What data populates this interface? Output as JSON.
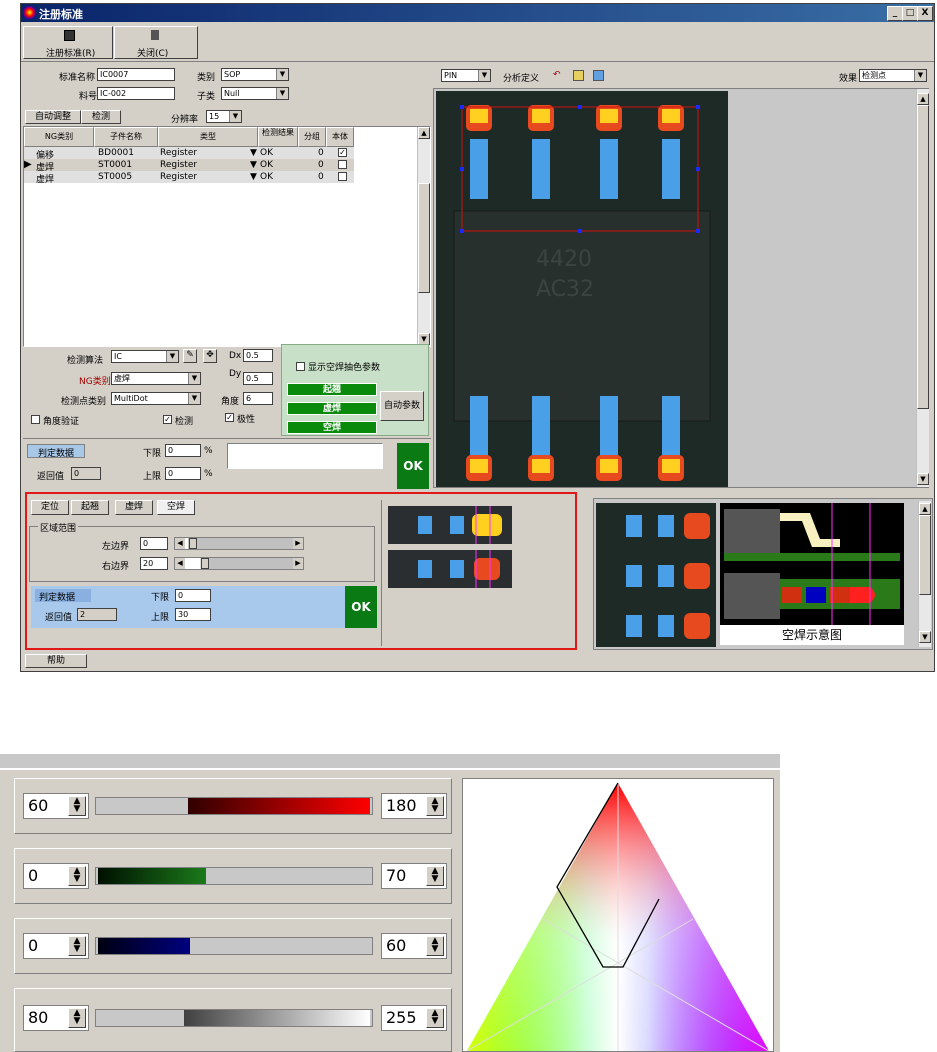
{
  "window": {
    "title": "注册标准",
    "controls": [
      "_",
      "□",
      "X"
    ]
  },
  "toolbar": {
    "register_label": "注册标准(R)",
    "close_label": "关闭(C)"
  },
  "form": {
    "std_name_label": "标准名称",
    "std_name_value": "IC0007",
    "category_label": "类别",
    "category_value": "SOP",
    "part_no_label": "料号",
    "part_no_value": "IC-002",
    "subcat_label": "子类",
    "subcat_value": "Null"
  },
  "tabs": {
    "auto_adjust": "自动调整",
    "detect": "检测",
    "resolution_label": "分辨率",
    "resolution_value": "15"
  },
  "grid": {
    "headers": [
      "NG类别",
      "子件名称",
      "类型",
      "检测结果",
      "分组",
      "本体"
    ],
    "rows": [
      {
        "ng": "偏移",
        "name": "BD0001",
        "type": "Register",
        "result": "OK",
        "group": "0",
        "body": "✓"
      },
      {
        "ng": "虚焊",
        "name": "ST0001",
        "type": "Register",
        "result": "OK",
        "group": "0",
        "body": ""
      },
      {
        "ng": "虚焊",
        "name": "ST0005",
        "type": "Register",
        "result": "OK",
        "group": "0",
        "body": ""
      }
    ]
  },
  "algo": {
    "algo_label": "检测算法",
    "algo_value": "IC",
    "ng_label": "NG类别",
    "ng_value": "虚焊",
    "point_label": "检测点类别",
    "point_value": "MultiDot",
    "angle_check_label": "角度验证",
    "detect_check_label": "检测",
    "polarity_check_label": "极性",
    "dx_label": "Dx",
    "dx_value": "0.5",
    "dy_label": "Dy",
    "dy_value": "0.5",
    "angle_label": "角度",
    "angle_value": "6"
  },
  "solder": {
    "show_params_label": "显示空焊抽色参数",
    "btn_raise": "起翘",
    "btn_false": "虚焊",
    "btn_empty": "空焊",
    "auto_params": "自动参数"
  },
  "judge": {
    "judge_label": "判定数据",
    "return_label": "返回值",
    "return_value": "0",
    "lower_label": "下限",
    "lower_value": "0",
    "upper_label": "上限",
    "upper_value": "0",
    "pct": "%",
    "ok": "OK"
  },
  "viewer": {
    "pin_value": "PIN",
    "analysis_label": "分析定义",
    "effect_label": "效果",
    "effect_value": "检测点"
  },
  "lower": {
    "tabs": [
      "定位",
      "起翘",
      "虚焊",
      "空焊"
    ],
    "range_group": "区域范围",
    "left_label": "左边界",
    "left_value": "0",
    "right_label": "右边界",
    "right_value": "20",
    "judge_label": "判定数据",
    "return_label": "返回值",
    "return_value": "2",
    "lower_label": "下限",
    "lower_value": "0",
    "upper_label": "上限",
    "upper_value": "30",
    "ok": "OK",
    "diagram_caption": "空焊示意图"
  },
  "status": {
    "help": "帮助"
  },
  "color_panel": {
    "rows": [
      {
        "min": "60",
        "max": "180",
        "color": "#e00000"
      },
      {
        "min": "0",
        "max": "70",
        "color": "#1a7a1a"
      },
      {
        "min": "0",
        "max": "60",
        "color": "#000080"
      },
      {
        "min": "80",
        "max": "255",
        "color": "#ffffff"
      }
    ]
  }
}
